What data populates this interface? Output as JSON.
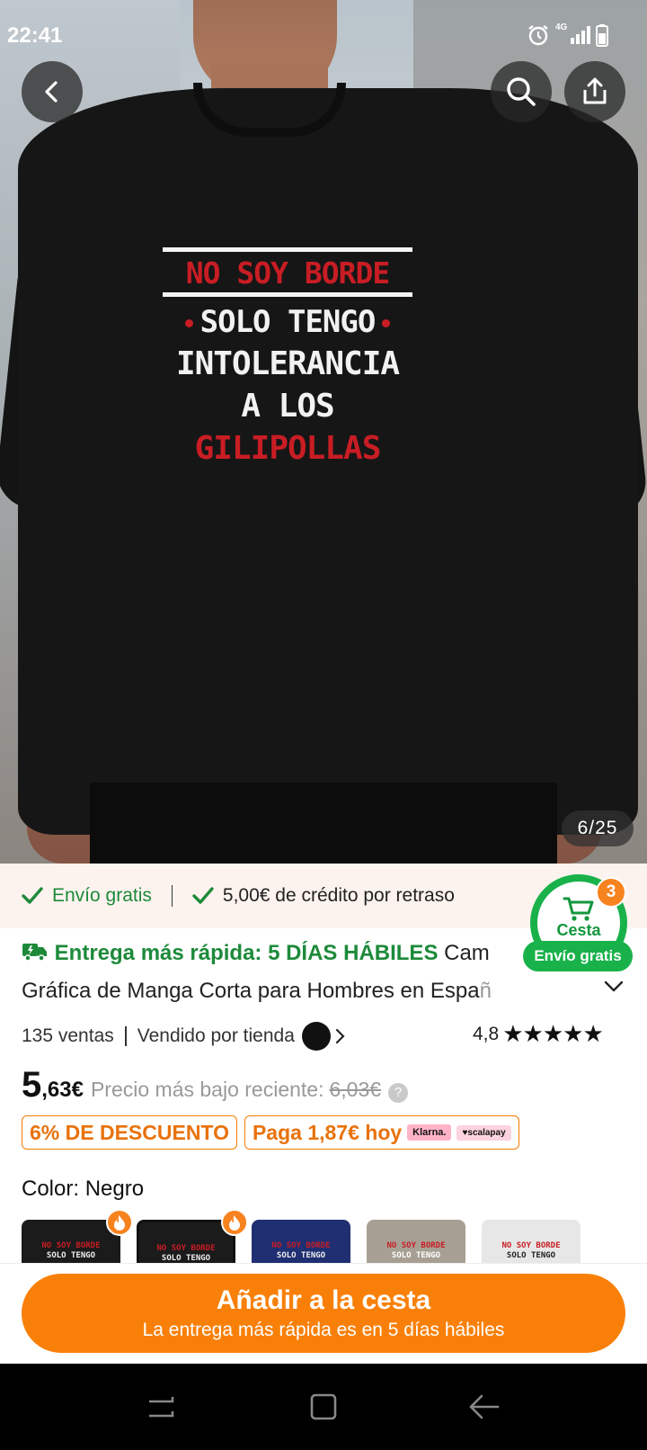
{
  "status_bar": {
    "time": "22:41",
    "network": "4G"
  },
  "product_image": {
    "print_lines": [
      "NO SOY BORDE",
      "SOLO TENGO",
      "INTOLERANCIA",
      "A LOS",
      "GILIPOLLAS"
    ],
    "counter": "6/25"
  },
  "info_strip": {
    "free_shipping": "Envío gratis",
    "delay_credit": "5,00€ de crédito por retraso"
  },
  "cart": {
    "label": "Cesta",
    "count": "3",
    "free_shipping": "Envío gratis"
  },
  "title": {
    "delivery": "Entrega más rápida: 5 DÍAS HÁBILES",
    "line1_rest": " Cam",
    "line2": "Gráfica de Manga Corta para Hombres en Espa",
    "line2_fade": "ñ"
  },
  "meta": {
    "sales": "135 ventas",
    "sold_by": "Vendido por tienda",
    "rating": "4,8",
    "stars": "★★★★★"
  },
  "price": {
    "integer": "5",
    "decimal": ",63€",
    "recent_label": "Precio más bajo reciente:",
    "old": "6,03€"
  },
  "badges": {
    "discount": "6% DE DESCUENTO",
    "pay_today": "Paga 1,87€ hoy",
    "klarna": "Klarna.",
    "scalapay": "♥scalapay"
  },
  "color": {
    "label": "Color: Negro"
  },
  "swatches": [
    {
      "color": "#1b1b1b",
      "top_text": "NO SOY BORDE",
      "bottom_text": "SOLO TENGO"
    },
    {
      "color": "#1b1b1b",
      "top_text": "NO SOY BORDE",
      "bottom_text": "SOLO TENGO"
    },
    {
      "color": "#1f2f72",
      "top_text": "NO SOY BORDE",
      "bottom_text": "SOLO TENGO"
    },
    {
      "color": "#a79f93",
      "top_text": "NO SOY BORDE",
      "bottom_text": "SOLO TENGO"
    },
    {
      "color": "#e7e7e7",
      "top_text": "NO SOY BORDE",
      "bottom_text": "SOLO TENGO"
    }
  ],
  "cta": {
    "main": "Añadir a la cesta",
    "sub": "La entrega más rápida es en 5 días hábiles"
  },
  "colors": {
    "accent": "#f98008",
    "green": "#1d8a3a",
    "cart_green": "#19b24a"
  }
}
